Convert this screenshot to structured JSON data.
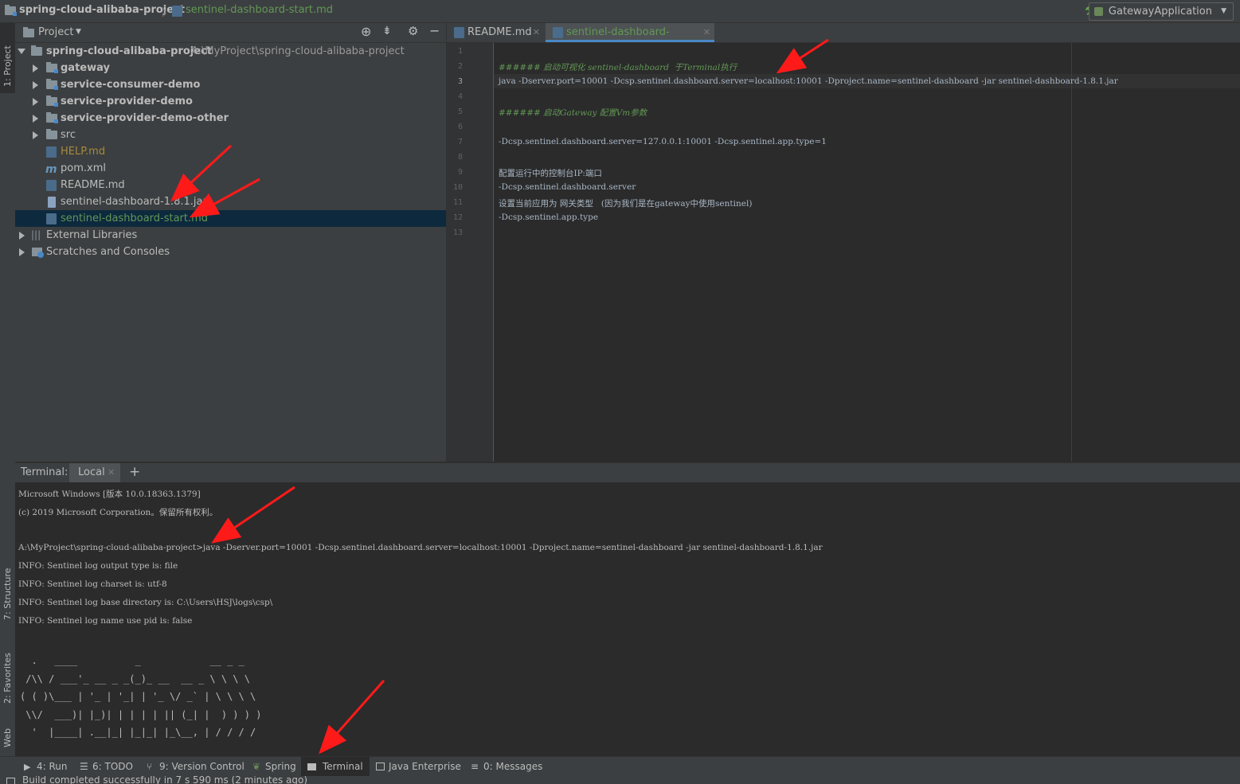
{
  "navbar": {
    "project_name": "spring-cloud-alibaba-project",
    "separator": "〉",
    "file_name": "sentinel-dashboard-start.md",
    "run_config": "GatewayApplication"
  },
  "left_stripe": {
    "project_tab": "1: Project",
    "structure_tab": "7: Structure",
    "favorites_tab": "2: Favorites",
    "web_tab": "Web"
  },
  "project_panel": {
    "title": "Project",
    "root": {
      "name": "spring-cloud-alibaba-project",
      "path": "A:\\MyProject\\spring-cloud-alibaba-project"
    },
    "items": [
      {
        "label": "gateway"
      },
      {
        "label": "service-consumer-demo"
      },
      {
        "label": "service-provider-demo"
      },
      {
        "label": "service-provider-demo-other"
      },
      {
        "label": "src"
      },
      {
        "label": "HELP.md"
      },
      {
        "label": "pom.xml"
      },
      {
        "label": "README.md"
      },
      {
        "label": "sentinel-dashboard-1.8.1.jar"
      },
      {
        "label": "sentinel-dashboard-start.md"
      },
      {
        "label": "External Libraries"
      },
      {
        "label": "Scratches and Consoles"
      }
    ]
  },
  "editor": {
    "tabs": [
      {
        "label": "README.md"
      },
      {
        "label": "sentinel-dashboard-start.md"
      }
    ],
    "current_line": 3,
    "line_numbers": [
      "1",
      "2",
      "3",
      "4",
      "5",
      "6",
      "7",
      "8",
      "9",
      "10",
      "11",
      "12",
      "13"
    ],
    "lines": [
      "",
      "###### 启动可视化 sentinel-dashboard  于Terminal执行",
      "java -Dserver.port=10001 -Dcsp.sentinel.dashboard.server=localhost:10001 -Dproject.name=sentinel-dashboard -jar sentinel-dashboard-1.8.1.jar",
      "",
      "###### 启动Gateway 配置Vm参数",
      "",
      "-Dcsp.sentinel.dashboard.server=127.0.0.1:10001 -Dcsp.sentinel.app.type=1",
      "",
      "配置运行中的控制台IP:端口",
      "-Dcsp.sentinel.dashboard.server",
      "设置当前应用为 网关类型   (因为我们是在gateway中使用sentinel)",
      "-Dcsp.sentinel.app.type",
      ""
    ]
  },
  "terminal": {
    "label": "Terminal:",
    "tab": "Local",
    "add": "+",
    "lines": [
      "Microsoft Windows [版本 10.0.18363.1379]",
      "(c) 2019 Microsoft Corporation。保留所有权利。",
      "",
      "A:\\MyProject\\spring-cloud-alibaba-project>java -Dserver.port=10001 -Dcsp.sentinel.dashboard.server=localhost:10001 -Dproject.name=sentinel-dashboard -jar sentinel-dashboard-1.8.1.jar",
      "INFO: Sentinel log output type is: file",
      "INFO: Sentinel log charset is: utf-8",
      "INFO: Sentinel log base directory is: C:\\Users\\HSJ\\logs\\csp\\",
      "INFO: Sentinel log name use pid is: false"
    ],
    "banner": [
      "  .   ____          _            __ _ _",
      " /\\\\ / ___'_ __ _ _(_)_ __  __ _ \\ \\ \\ \\",
      "( ( )\\___ | '_ | '_| | '_ \\/ _` | \\ \\ \\ \\",
      " \\\\/  ___)| |_)| | | | | || (_| |  ) ) ) )",
      "  '  |____| .__|_| |_|_| |_\\__, | / / / /"
    ]
  },
  "bottom_tools": [
    {
      "label": "4: Run"
    },
    {
      "label": "6: TODO"
    },
    {
      "label": "9: Version Control"
    },
    {
      "label": "Spring"
    },
    {
      "label": "Terminal"
    },
    {
      "label": "Java Enterprise"
    },
    {
      "label": "0: Messages"
    }
  ],
  "status": {
    "text": "Build completed successfully in 7 s 590 ms (2 minutes ago)"
  },
  "colors": {
    "accent": "#4a88c7",
    "selection": "#0d293e",
    "annotation_arrow": "#ff1a1a",
    "modified_file": "#629755",
    "help_file": "#a68b3a"
  }
}
